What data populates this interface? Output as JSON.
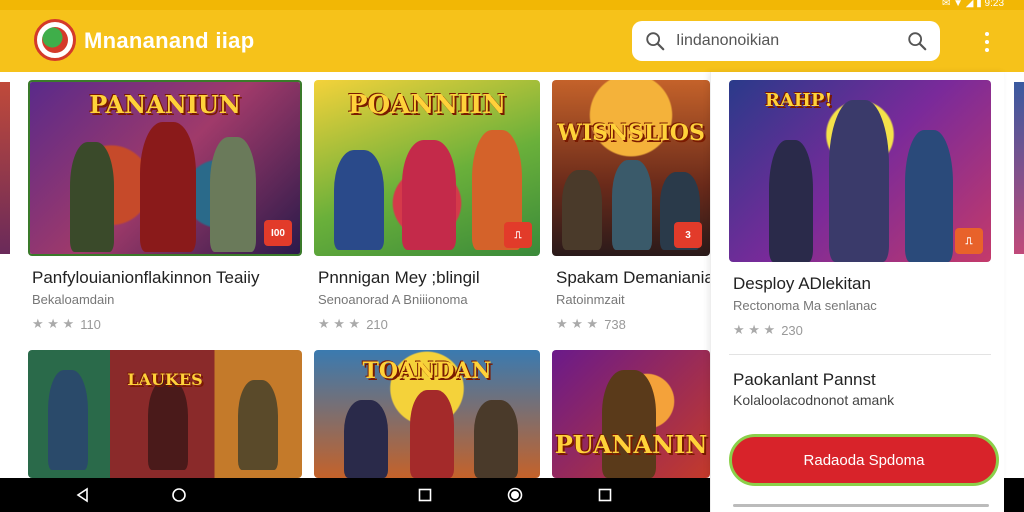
{
  "app": {
    "title": "Mnananand iiap",
    "logo": "app-logo"
  },
  "search": {
    "placeholder": "",
    "value": "Iindanonoikian"
  },
  "icons": {
    "search": "search-icon",
    "menu": "more-vert-icon"
  },
  "colors": {
    "app_bar": "#f6c21a",
    "cta": "#d8232a",
    "cta_border": "#8bd04a"
  },
  "status": {
    "icons_text": "✉ ▼ ◢ ▮ 9:23"
  },
  "cards": [
    {
      "banner": "PANANIUN",
      "badge": "I00",
      "title": "Panfylouianionflakinnon Teaiiy",
      "subtitle": "Bekaloamdain",
      "rating": "110"
    },
    {
      "banner": "POANNIIN",
      "badge": "⎍",
      "title": "Pnnnigan Mey ;blingil",
      "subtitle": "Senoanorad A Bniiionoma",
      "rating": "210"
    },
    {
      "banner": "WISNSLIOS",
      "badge": "3",
      "title": "Spakam Demanianial",
      "subtitle": "Ratoinmzait",
      "rating": "738"
    }
  ],
  "row2": [
    {
      "banner": "LAUKES",
      "badge": ""
    },
    {
      "banner": "TOANDAN",
      "badge": ""
    },
    {
      "banner": "PUANANIN",
      "badge": ""
    }
  ],
  "side_panel": {
    "banner": "RAHP!",
    "badge": "⎍",
    "title": "Desploy ADlekitan",
    "subtitle": "Rectonoma Ma senlanac",
    "rating": "230",
    "section_title": "Paokanlant Pannst",
    "section_subtitle": "Kolaloolacodnonot amank",
    "cta_label": "Radaoda Spdoma"
  },
  "rating_stars": "★ ★ ★"
}
